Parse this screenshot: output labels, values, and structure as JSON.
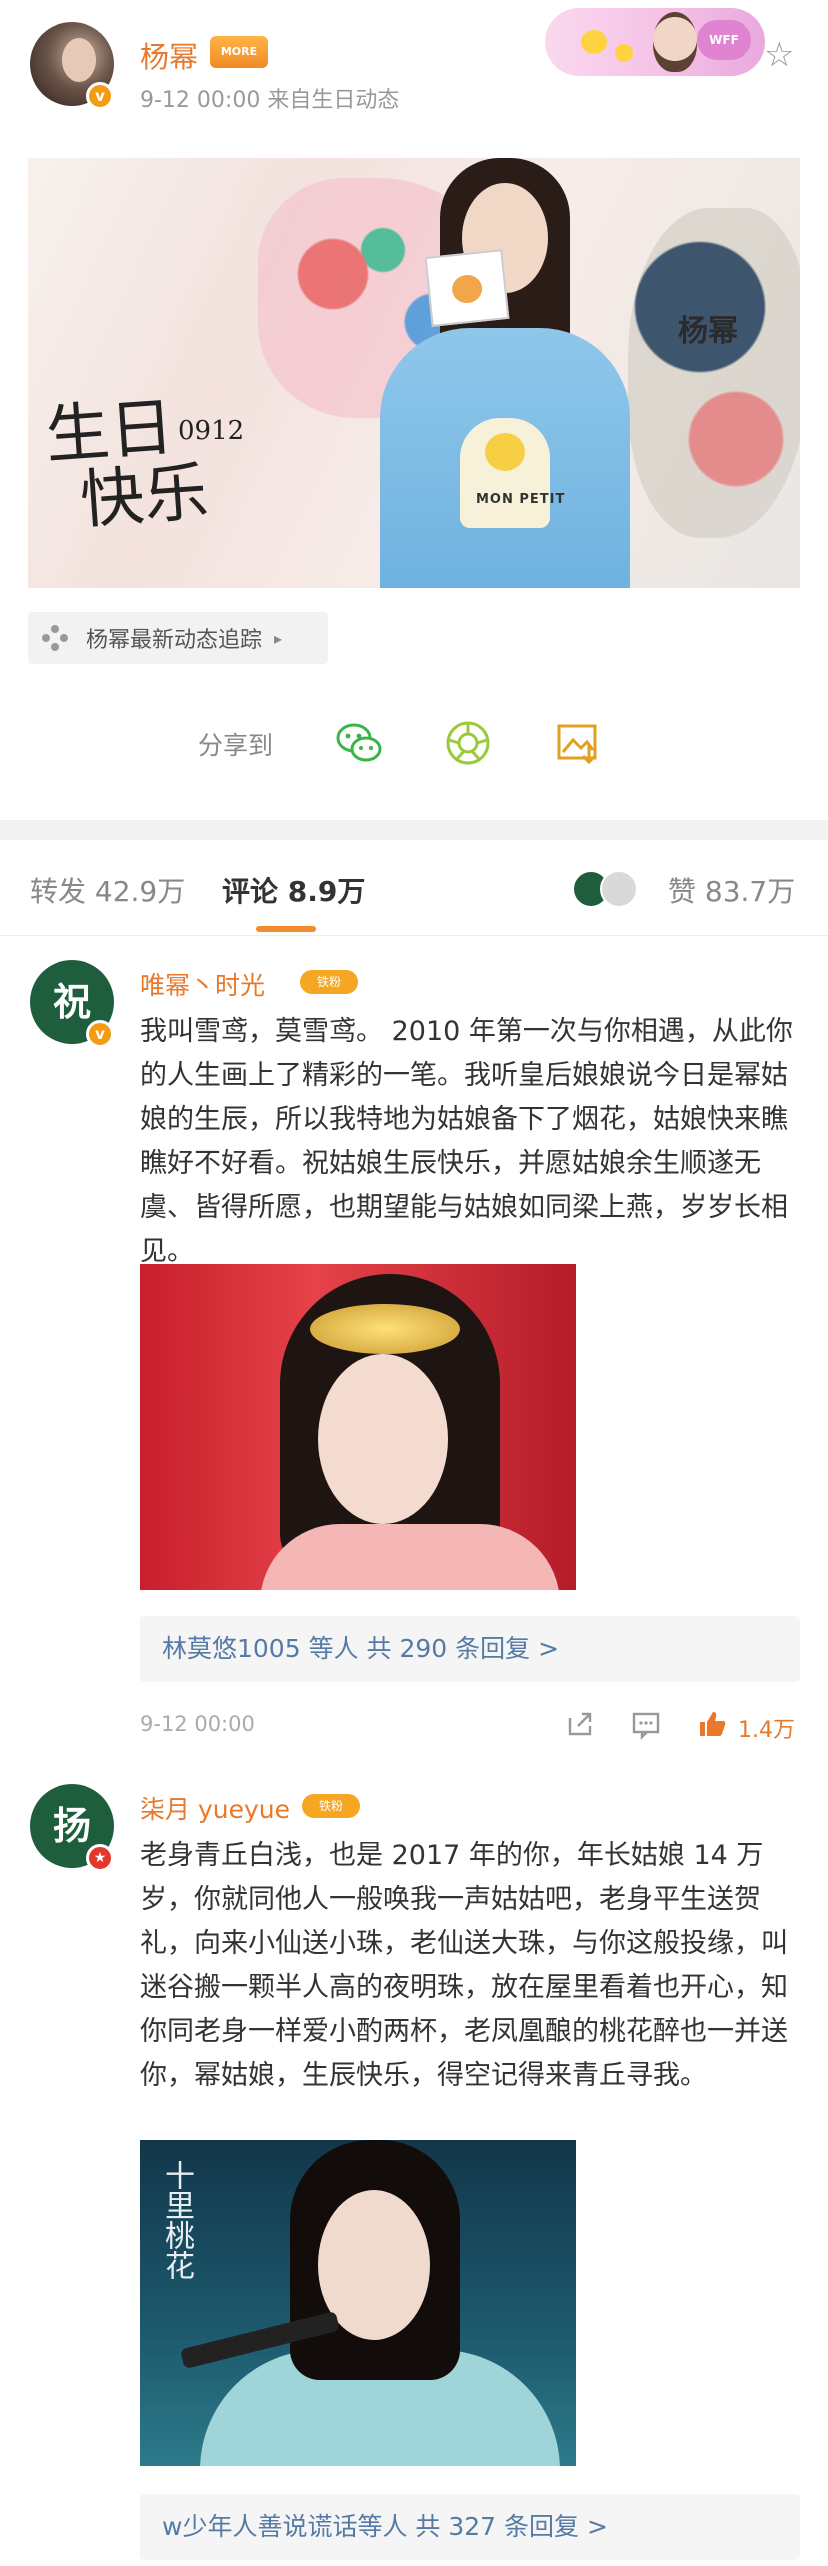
{
  "post": {
    "author": "杨幂",
    "meta": "9-12 00:00   来自生日动态",
    "vip_label": "MORE",
    "sticker_tag": "WFF"
  },
  "banner": {
    "title_line1": "生日",
    "title_line2": "快乐",
    "date": "0912",
    "signature": "杨幂",
    "sweater_text": "MON PETIT"
  },
  "tracking": {
    "label": "杨幂最新动态追踪",
    "arrow": "▸"
  },
  "share": {
    "label": "分享到"
  },
  "tabs": {
    "repost": "转发 42.9万",
    "comments": "评论 8.9万",
    "likes": "赞 83.7万"
  },
  "comments": [
    {
      "name": "唯幂丶时光",
      "fan_tag": "铁粉",
      "avatar_char": "祝",
      "text": "我叫雪鸢，莫雪鸢。 2010 年第一次与你相遇，从此你的人生画上了精彩的一笔。我听皇后娘娘说今日是幂姑娘的生辰，所以我特地为姑娘备下了烟花，姑娘快来瞧瞧好不好看。祝姑娘生辰快乐，并愿姑娘余生顺遂无虞、皆得所愿，也期望能与姑娘如同梁上燕，岁岁长相见。",
      "replies": "林莫悠1005 等人  共 290 条回复 >",
      "time": "9-12 00:00",
      "likes": "1.4万"
    },
    {
      "name": "柒月 yueyue",
      "fan_tag": "铁粉",
      "avatar_char": "扬",
      "text": "老身青丘白浅，也是 2017 年的你，年长姑娘 14 万岁，你就同他人一般唤我一声姑姑吧，老身平生送贺礼，向来小仙送小珠，老仙送大珠，与你这般投缘，叫迷谷搬一颗半人高的夜明珠，放在屋里看着也开心，知你同老身一样爱小酌两杯，老凤凰酿的桃花醉也一并送你，幂姑娘，生辰快乐，得空记得来青丘寻我。",
      "photo_caption": "十里桃花",
      "replies": "w少年人善说谎话等人  共 327 条回复 >"
    }
  ],
  "colors": {
    "accent": "#e8792b",
    "link": "#557ba5",
    "badge": "#f39c12",
    "avatar_green": "#1f5e3c"
  }
}
